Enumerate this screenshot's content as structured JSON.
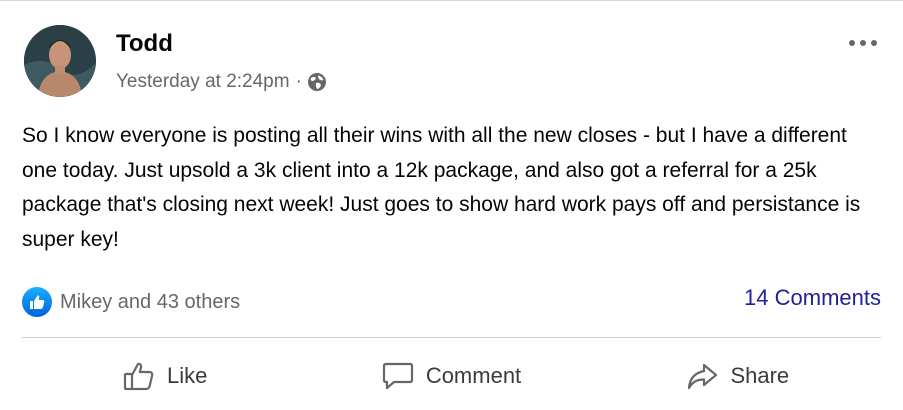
{
  "post": {
    "author": "Todd",
    "timestamp": "Yesterday at 2:24pm",
    "separator": "·",
    "privacy_icon": "globe-icon",
    "more_icon": "more-options-icon",
    "text": "So I know everyone is posting all their wins with all the new closes - but I have a different one today. Just upsold a 3k client into a 12k package, and also got a referral for a 25k package that's closing next week! Just goes to show hard work pays off and persistance is super key!",
    "reactions_summary": "Mikey and 43 others",
    "comments_count": "14 Comments"
  },
  "actions": {
    "like_label": "Like",
    "comment_label": "Comment",
    "share_label": "Share"
  },
  "colors": {
    "like_blue": "#0866ff",
    "meta_gray": "#65676b",
    "comments_link": "#1f1f9a"
  }
}
